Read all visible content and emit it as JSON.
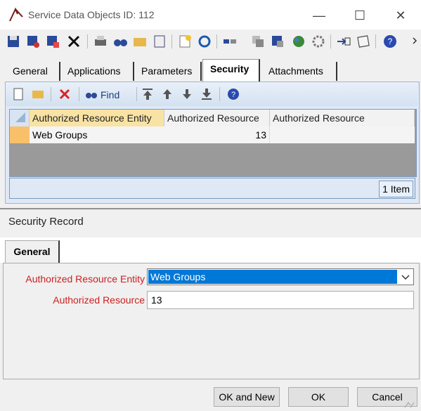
{
  "window": {
    "title": "Service Data Objects ID: 112"
  },
  "titlebar": {
    "minimize": "—",
    "maximize": "☐",
    "close": "✕"
  },
  "tabs": [
    {
      "label": "General"
    },
    {
      "label": "Applications"
    },
    {
      "label": "Parameters"
    },
    {
      "label": "Security",
      "active": true
    },
    {
      "label": "Attachments"
    }
  ],
  "subtoolbar": {
    "find_label": "Find"
  },
  "grid": {
    "columns": [
      "Authorized Resource Entity",
      "Authorized Resource",
      "Authorized Resource"
    ],
    "rows": [
      {
        "entity": "Web Groups",
        "resource": "13",
        "resource_name": ""
      }
    ],
    "status": "1 Item"
  },
  "dialog": {
    "title": "Security Record",
    "tab": "General",
    "fields": {
      "entity_label": "Authorized Resource Entity",
      "entity_value": "Web Groups",
      "resource_label": "Authorized Resource",
      "resource_value": "13"
    },
    "buttons": {
      "ok_new": "OK and New",
      "ok": "OK",
      "cancel": "Cancel"
    }
  },
  "colors": {
    "accent": "#0078d7",
    "required_label": "#cc2020",
    "panel": "#dfe9f5"
  }
}
